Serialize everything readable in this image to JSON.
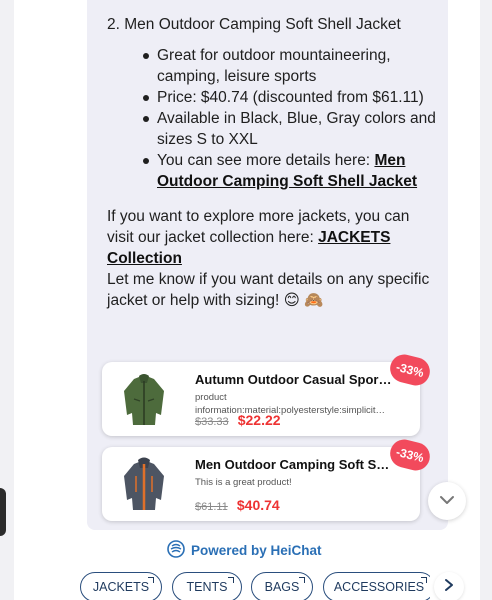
{
  "message": {
    "heading": "2. Men Outdoor Camping Soft Shell Jacket",
    "bullets": [
      {
        "text": "Great for outdoor mountaineering, camping, leisure sports"
      },
      {
        "text": "Price: $40.74 (discounted from $61.11)"
      },
      {
        "text": "Available in Black, Blue, Gray colors and sizes S to XXL"
      },
      {
        "text": "You can see more details here: ",
        "link": "Men Outdoor Camping Soft Shell Jacket"
      }
    ],
    "para1_prefix": "If you want to explore more jackets, you can visit our jacket collection here: ",
    "para1_link": "JACKETS Collection",
    "para2": "Let me know if you want details on any specific jacket or help with sizing! 😊 🙈"
  },
  "products": [
    {
      "title": "Autumn Outdoor Casual Sports…",
      "desc": "product information:material:polyesterstyle:simplicit…",
      "old_price": "$33.33",
      "new_price": "$22.22",
      "badge": "-33%",
      "icon": "green-jacket-icon"
    },
    {
      "title": "Men Outdoor Camping Soft Shell…",
      "desc": "This is a great product!",
      "old_price": "$61.11",
      "new_price": "$40.74",
      "badge": "-33%",
      "icon": "gray-orange-jacket-icon"
    }
  ],
  "powered_by": "Powered by HeiChat",
  "chips": [
    "JACKETS",
    "TENTS",
    "BAGS",
    "ACCESSORIES"
  ],
  "colors": {
    "accent": "#2a6fb5",
    "discount": "#ee3333",
    "badge": "#f24a5c",
    "bubble": "#eeeef6",
    "chip_border": "#2a4e7d"
  },
  "icons": {
    "scroll_down": "chevron-down-icon",
    "powered": "heichat-logo-icon",
    "chips_next": "chevron-right-icon"
  }
}
